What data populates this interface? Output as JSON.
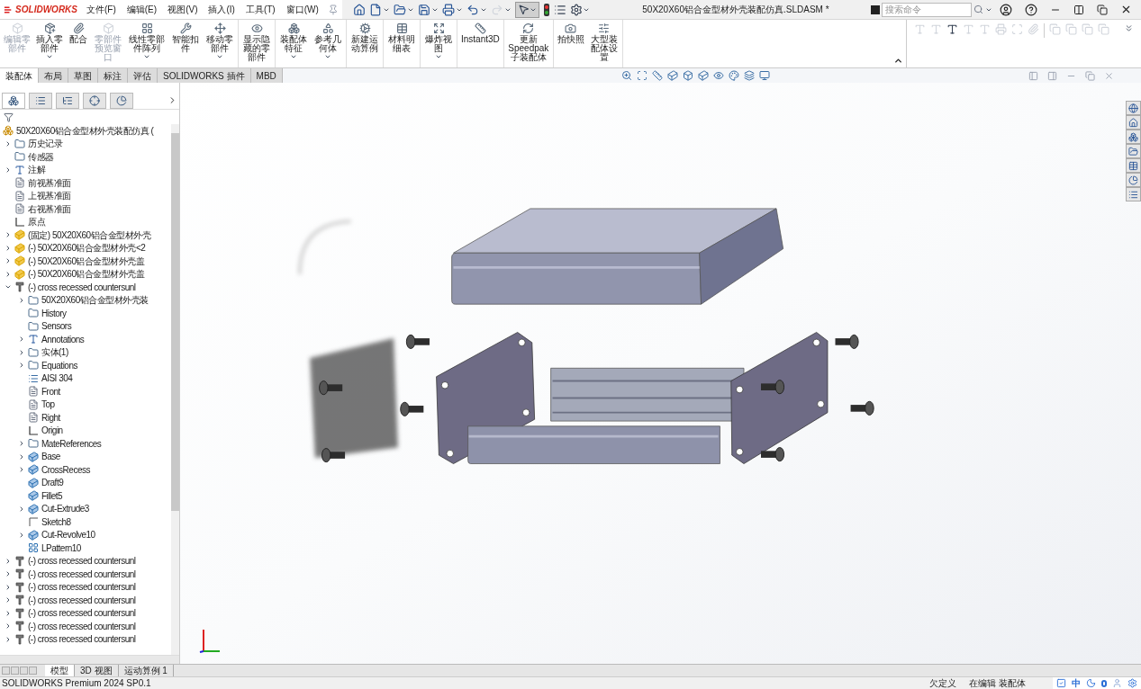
{
  "app": {
    "logo": "SOLIDWORKS",
    "title": "50X20X60铝合金型材外壳装配仿真.SLDASM *"
  },
  "menu": [
    "文件(F)",
    "编辑(E)",
    "视图(V)",
    "插入(I)",
    "工具(T)",
    "窗口(W)"
  ],
  "search": {
    "placeholder": "搜索命令"
  },
  "ribbon": {
    "groups": [
      [
        {
          "label": "编辑零部件",
          "disabled": true,
          "caret": false
        },
        {
          "label": "插入零部件",
          "disabled": false,
          "caret": true
        },
        {
          "label": "配合",
          "disabled": false,
          "caret": false
        },
        {
          "label": "零部件预览窗口",
          "disabled": true,
          "caret": false
        },
        {
          "label": "线性零部件阵列",
          "disabled": false,
          "caret": true
        },
        {
          "label": "智能扣件",
          "disabled": false,
          "caret": false
        },
        {
          "label": "移动零部件",
          "disabled": false,
          "caret": true
        }
      ],
      [
        {
          "label": "显示隐藏的零部件",
          "disabled": false,
          "caret": false
        }
      ],
      [
        {
          "label": "装配体特征",
          "disabled": false,
          "caret": true
        },
        {
          "label": "参考几何体",
          "disabled": false,
          "caret": true
        }
      ],
      [
        {
          "label": "新建运动算例",
          "disabled": false,
          "caret": false
        }
      ],
      [
        {
          "label": "材料明细表",
          "disabled": false,
          "caret": false
        }
      ],
      [
        {
          "label": "爆炸视图",
          "disabled": false,
          "caret": true
        }
      ],
      [
        {
          "label": "Instant3D",
          "disabled": false,
          "caret": false
        }
      ],
      [
        {
          "label": "更新Speedpak子装配体",
          "disabled": false,
          "caret": false
        }
      ],
      [
        {
          "label": "拍快照",
          "disabled": false,
          "caret": false
        },
        {
          "label": "大型装配体设置",
          "disabled": false,
          "caret": false
        }
      ]
    ]
  },
  "tabs": [
    {
      "label": "装配体",
      "selected": true
    },
    {
      "label": "布局",
      "selected": false
    },
    {
      "label": "草图",
      "selected": false
    },
    {
      "label": "标注",
      "selected": false
    },
    {
      "label": "评估",
      "selected": false
    },
    {
      "label": "SOLIDWORKS 插件",
      "selected": false
    },
    {
      "label": "MBD",
      "selected": false
    }
  ],
  "panel_tabs": [
    {
      "selected": true
    },
    {
      "selected": false
    },
    {
      "selected": false
    },
    {
      "selected": false
    },
    {
      "selected": false
    }
  ],
  "tree": {
    "label": "50X20X60铝合金型材外壳装配仿真 (",
    "kind": "assembly",
    "children": [
      {
        "label": "历史记录",
        "kind": "folder",
        "expanded": false
      },
      {
        "label": "传感器",
        "kind": "folder"
      },
      {
        "label": "注解",
        "kind": "annotation",
        "expanded": false
      },
      {
        "label": "前视基准面",
        "kind": "plane"
      },
      {
        "label": "上视基准面",
        "kind": "plane"
      },
      {
        "label": "右视基准面",
        "kind": "plane"
      },
      {
        "label": "原点",
        "kind": "origin"
      },
      {
        "label": "(固定) 50X20X60铝合金型材外壳",
        "kind": "part",
        "expanded": false
      },
      {
        "label": "(-) 50X20X60铝合金型材外壳<2",
        "kind": "part",
        "expanded": false
      },
      {
        "label": "(-) 50X20X60铝合金型材外壳盖",
        "kind": "part",
        "expanded": false
      },
      {
        "label": "(-) 50X20X60铝合金型材外壳盖",
        "kind": "part",
        "expanded": false
      },
      {
        "label": "(-) cross recessed countersunl",
        "kind": "screw",
        "expanded": true,
        "children": [
          {
            "label": "50X20X60铝合金型材外壳装",
            "kind": "folder",
            "expanded": false
          },
          {
            "label": "History",
            "kind": "folder"
          },
          {
            "label": "Sensors",
            "kind": "folder"
          },
          {
            "label": "Annotations",
            "kind": "annotation",
            "expanded": false
          },
          {
            "label": "实体(1)",
            "kind": "folder",
            "expanded": false
          },
          {
            "label": "Equations",
            "kind": "folder",
            "expanded": false
          },
          {
            "label": "AISI 304",
            "kind": "material"
          },
          {
            "label": "Front",
            "kind": "plane"
          },
          {
            "label": "Top",
            "kind": "plane"
          },
          {
            "label": "Right",
            "kind": "plane"
          },
          {
            "label": "Origin",
            "kind": "origin"
          },
          {
            "label": "MateReferences",
            "kind": "folder",
            "expanded": false
          },
          {
            "label": "Base",
            "kind": "feature",
            "expanded": false
          },
          {
            "label": "CrossRecess",
            "kind": "feature",
            "expanded": false
          },
          {
            "label": "Draft9",
            "kind": "feature"
          },
          {
            "label": "Fillet5",
            "kind": "feature"
          },
          {
            "label": "Cut-Extrude3",
            "kind": "feature",
            "expanded": false
          },
          {
            "label": "Sketch8",
            "kind": "sketch"
          },
          {
            "label": "Cut-Revolve10",
            "kind": "feature",
            "expanded": false
          },
          {
            "label": "LPattern10",
            "kind": "pattern"
          }
        ]
      },
      {
        "label": "(-) cross recessed countersunl",
        "kind": "screw",
        "expanded": false
      },
      {
        "label": "(-) cross recessed countersunl",
        "kind": "screw",
        "expanded": false
      },
      {
        "label": "(-) cross recessed countersunl",
        "kind": "screw",
        "expanded": false
      },
      {
        "label": "(-) cross recessed countersunl",
        "kind": "screw",
        "expanded": false
      },
      {
        "label": "(-) cross recessed countersunl",
        "kind": "screw",
        "expanded": false
      },
      {
        "label": "(-) cross recessed countersunl",
        "kind": "screw",
        "expanded": false
      },
      {
        "label": "(-) cross recessed countersunl",
        "kind": "screw",
        "expanded": false
      }
    ]
  },
  "bottom_tabs": [
    {
      "label": "模型",
      "selected": true
    },
    {
      "label": "3D 视图",
      "selected": false
    },
    {
      "label": "运动算例 1",
      "selected": false
    }
  ],
  "status_bar": {
    "product": "SOLIDWORKS Premium 2024 SP0.1",
    "state": "欠定义",
    "mode": "在编辑 装配体",
    "ime": "中"
  }
}
